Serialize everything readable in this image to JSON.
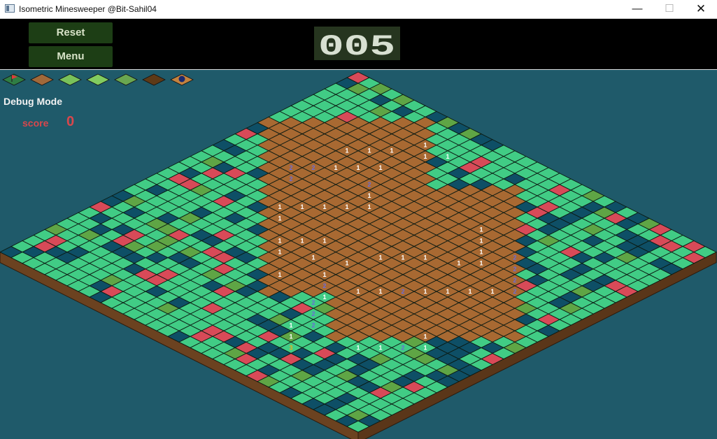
{
  "window": {
    "title": "Isometric Minesweeper @Bit-Sahil04"
  },
  "controls": {
    "reset_label": "Reset",
    "menu_label": "Menu"
  },
  "timer": {
    "value": "005"
  },
  "status": {
    "debug_label": "Debug Mode",
    "score_label": "score",
    "score_value": "0"
  },
  "toolbar": {
    "tiles": [
      {
        "icon": "flag-tile-icon",
        "color": "#2f7d44"
      },
      {
        "icon": "dirt-tile-icon",
        "color": "#a0693a"
      },
      {
        "icon": "grass-tile-icon",
        "color": "#79c25a"
      },
      {
        "icon": "grass-tile-icon",
        "color": "#82cc5f"
      },
      {
        "icon": "grass-dark-tile-icon",
        "color": "#6aa650"
      },
      {
        "icon": "mud-tile-icon",
        "color": "#5e3a17"
      },
      {
        "icon": "mine-tile-icon",
        "color": "#c2823f"
      }
    ]
  },
  "colors": {
    "hidden": "#41cc85",
    "safe": "#0e4f66",
    "mine": "#d84a58",
    "grass": "#5fa545",
    "revealed": "#a86932",
    "number_one": "#ffffff",
    "number_two": "#6b6bd6",
    "number_three": "#e8b020",
    "background": "#1f5a6a",
    "grid": "#0b1a12"
  },
  "board": {
    "size": 32,
    "numbers": [
      {
        "r": 3,
        "c": 9,
        "v": "1"
      },
      {
        "r": 4,
        "c": 10,
        "v": "1"
      },
      {
        "r": 3,
        "c": 11,
        "v": "1"
      },
      {
        "r": 5,
        "c": 8,
        "v": "1"
      },
      {
        "r": 6,
        "c": 7,
        "v": "1"
      },
      {
        "r": 7,
        "c": 6,
        "v": "1"
      },
      {
        "r": 7,
        "c": 9,
        "v": "1"
      },
      {
        "r": 8,
        "c": 8,
        "v": "1"
      },
      {
        "r": 9,
        "c": 7,
        "v": "1"
      },
      {
        "r": 10,
        "c": 6,
        "v": "2"
      },
      {
        "r": 9,
        "c": 10,
        "v": "2"
      },
      {
        "r": 11,
        "c": 5,
        "v": "2"
      },
      {
        "r": 12,
        "c": 6,
        "v": "2"
      },
      {
        "r": 10,
        "c": 11,
        "v": "1"
      },
      {
        "r": 11,
        "c": 12,
        "v": "1"
      },
      {
        "r": 12,
        "c": 11,
        "v": "1"
      },
      {
        "r": 13,
        "c": 10,
        "v": "1"
      },
      {
        "r": 14,
        "c": 9,
        "v": "1"
      },
      {
        "r": 15,
        "c": 8,
        "v": "1"
      },
      {
        "r": 16,
        "c": 9,
        "v": "1"
      },
      {
        "r": 16,
        "c": 13,
        "v": "1"
      },
      {
        "r": 17,
        "c": 12,
        "v": "1"
      },
      {
        "r": 18,
        "c": 11,
        "v": "1"
      },
      {
        "r": 19,
        "c": 12,
        "v": "1"
      },
      {
        "r": 18,
        "c": 14,
        "v": "1"
      },
      {
        "r": 17,
        "c": 16,
        "v": "1"
      },
      {
        "r": 15,
        "c": 17,
        "v": "1"
      },
      {
        "r": 14,
        "c": 18,
        "v": "1"
      },
      {
        "r": 13,
        "c": 19,
        "v": "1"
      },
      {
        "r": 12,
        "c": 21,
        "v": "1"
      },
      {
        "r": 11,
        "c": 22,
        "v": "1"
      },
      {
        "r": 10,
        "c": 21,
        "v": "1"
      },
      {
        "r": 9,
        "c": 20,
        "v": "1"
      },
      {
        "r": 8,
        "c": 19,
        "v": "1"
      },
      {
        "r": 9,
        "c": 23,
        "v": "2"
      },
      {
        "r": 10,
        "c": 24,
        "v": "2"
      },
      {
        "r": 11,
        "c": 25,
        "v": "2"
      },
      {
        "r": 12,
        "c": 26,
        "v": "2"
      },
      {
        "r": 13,
        "c": 25,
        "v": "1"
      },
      {
        "r": 14,
        "c": 24,
        "v": "1"
      },
      {
        "r": 15,
        "c": 23,
        "v": "1"
      },
      {
        "r": 16,
        "c": 22,
        "v": "1"
      },
      {
        "r": 17,
        "c": 21,
        "v": "2"
      },
      {
        "r": 18,
        "c": 20,
        "v": "1"
      },
      {
        "r": 19,
        "c": 19,
        "v": "1"
      },
      {
        "r": 20,
        "c": 17,
        "v": "2"
      },
      {
        "r": 21,
        "c": 18,
        "v": "1"
      },
      {
        "r": 22,
        "c": 18,
        "v": "2"
      },
      {
        "r": 23,
        "c": 19,
        "v": "2"
      },
      {
        "r": 24,
        "c": 20,
        "v": "2"
      },
      {
        "r": 25,
        "c": 19,
        "v": "1"
      },
      {
        "r": 26,
        "c": 20,
        "v": "1"
      },
      {
        "r": 27,
        "c": 21,
        "v": "3"
      },
      {
        "r": 24,
        "c": 24,
        "v": "1"
      },
      {
        "r": 23,
        "c": 25,
        "v": "1"
      },
      {
        "r": 22,
        "c": 26,
        "v": "2"
      },
      {
        "r": 21,
        "c": 27,
        "v": "1"
      },
      {
        "r": 20,
        "c": 26,
        "v": "1"
      },
      {
        "r": 19,
        "c": 16,
        "v": "1"
      },
      {
        "r": 21,
        "c": 14,
        "v": "1"
      }
    ]
  }
}
